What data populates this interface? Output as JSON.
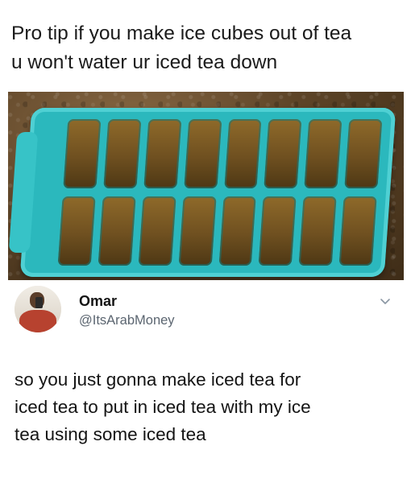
{
  "caption": {
    "lines": [
      "Pro tip if you make ice cubes out of tea",
      "u won't water ur iced tea down"
    ]
  },
  "photo": {
    "subject_icon": "ice-tray-image",
    "tray_color": "#2bb8bd",
    "tea_color": "#6f5020"
  },
  "tweet": {
    "display_name": "Omar",
    "handle": "@ItsArabMoney",
    "menu_icon": "chevron-down-icon",
    "lines": [
      "so you just gonna make iced tea for",
      "iced tea to put in iced tea with my ice",
      "tea using some iced tea"
    ]
  }
}
